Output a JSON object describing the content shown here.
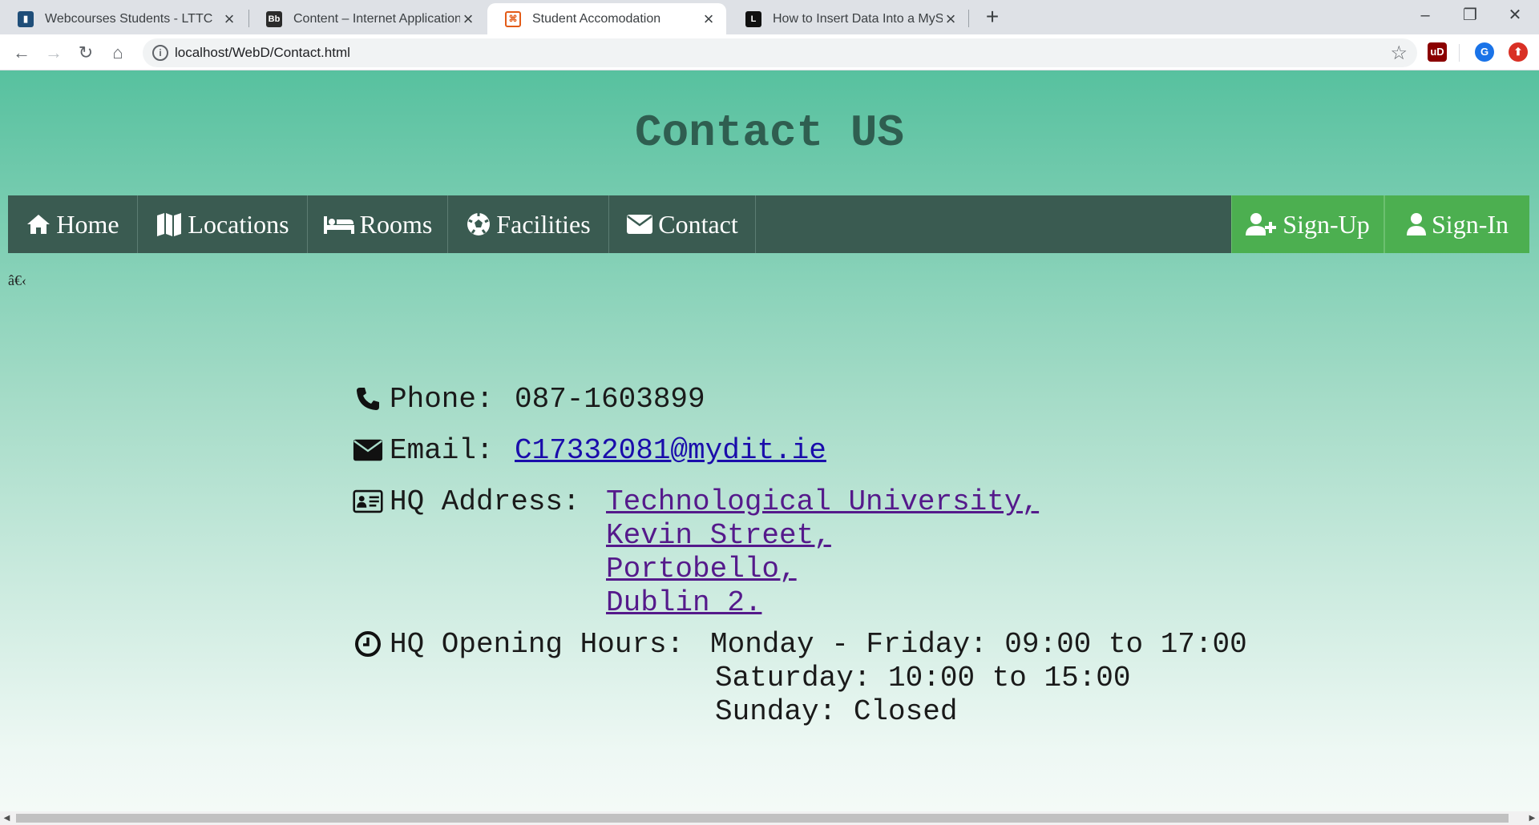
{
  "browser": {
    "tabs": [
      {
        "title": "Webcourses Students - LTTC",
        "favicon": "webcourses-icon"
      },
      {
        "title": "Content – Internet Application ar",
        "favicon": "blackboard-icon"
      },
      {
        "title": "Student Accomodation",
        "favicon": "html-file-icon"
      },
      {
        "title": "How to Insert Data Into a MySQL",
        "favicon": "lifewire-icon"
      }
    ],
    "active_tab": 2,
    "url": "localhost/WebD/Contact.html",
    "profile_initial": "G"
  },
  "page": {
    "heading": "Contact US",
    "stray_text": "â€‹",
    "nav": {
      "home": "Home",
      "locations": "Locations",
      "rooms": "Rooms",
      "facilities": "Facilities",
      "contact": "Contact",
      "signup": "Sign-Up",
      "signin": "Sign-In"
    },
    "contact": {
      "phone_label": "Phone:",
      "phone_value": "087-1603899",
      "email_label": "Email:",
      "email_value": "C17332081@mydit.ie",
      "address_label": "HQ Address:",
      "address_lines": [
        "Technological University,",
        "Kevin Street,",
        "Portobello,",
        "Dublin 2."
      ],
      "hours_label": "HQ Opening Hours:",
      "hours_lines": [
        "Monday - Friday: 09:00 to 17:00",
        "Saturday: 10:00 to 15:00",
        "Sunday: Closed"
      ]
    }
  },
  "colors": {
    "menu_bg": "#3a5b51",
    "menu_accent": "#4caf50",
    "heading": "#2f5e50"
  }
}
